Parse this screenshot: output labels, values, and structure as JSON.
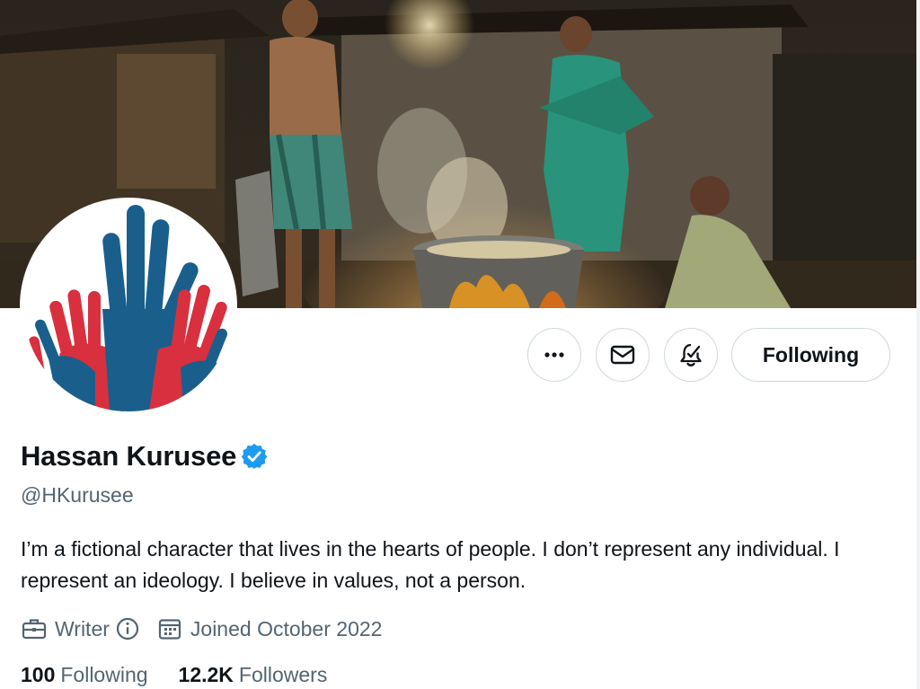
{
  "profile": {
    "display_name": "Hassan Kurusee",
    "handle": "@HKurusee",
    "bio": "I’m a fictional character that lives in the hearts of people. I don’t represent any individual. I represent an ideology. I believe in values, not a person.",
    "profession": "Writer",
    "joined": "Joined October 2022",
    "verified": true
  },
  "actions": {
    "more_icon": "ellipsis-icon",
    "message_icon": "envelope-icon",
    "notify_icon": "bell-plus-icon",
    "following_label": "Following"
  },
  "stats": {
    "following_count": "100",
    "following_label": "Following",
    "followers_count": "12.2K",
    "followers_label": "Followers"
  },
  "colors": {
    "verified_blue": "#1d9bf0",
    "text_primary": "#0f1419",
    "text_secondary": "#536471",
    "border": "#cfd9de",
    "avatar_red": "#d8303e",
    "avatar_blue": "#1a5f8c"
  }
}
